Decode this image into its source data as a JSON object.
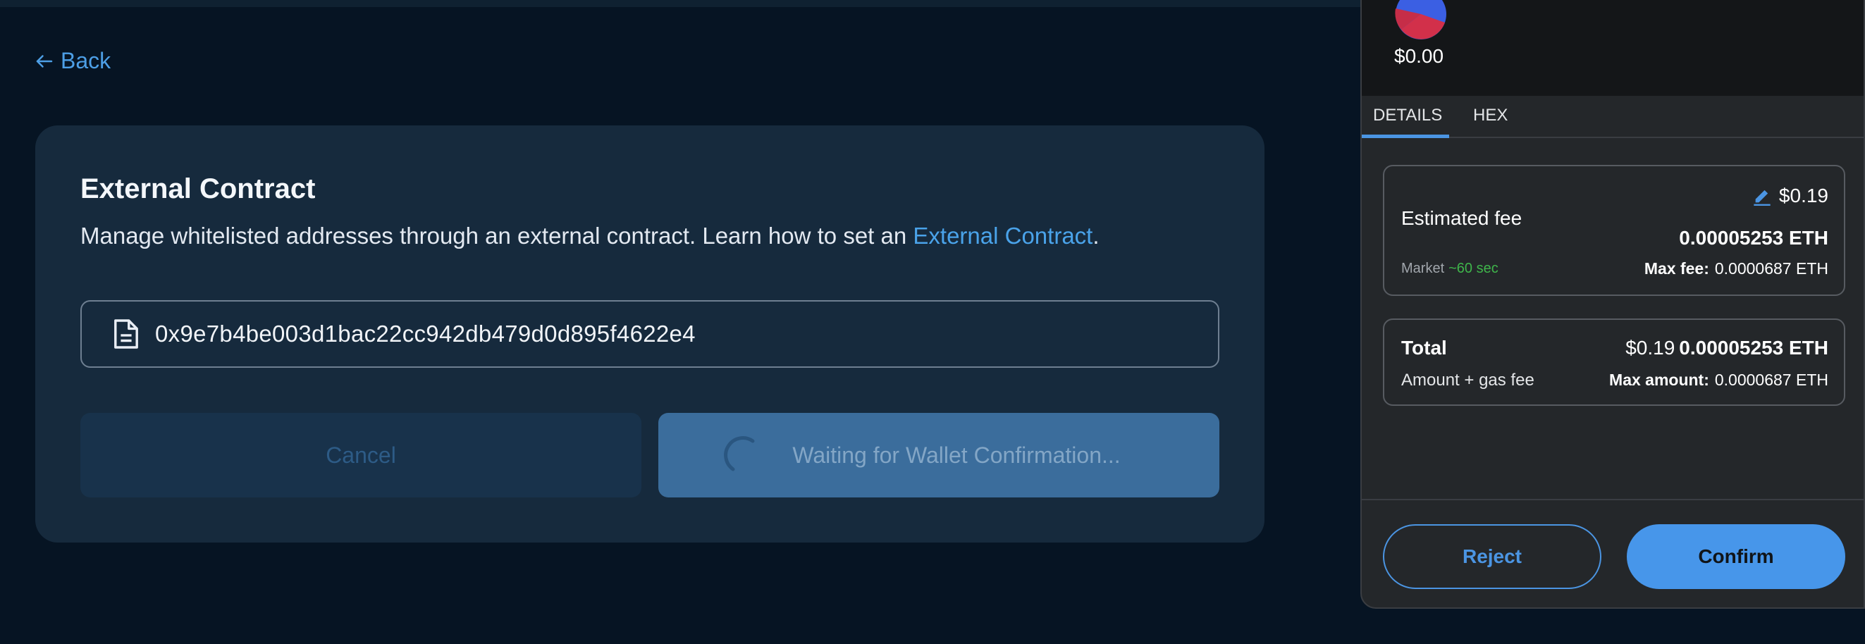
{
  "nav": {
    "back_label": "Back",
    "back_icon": "arrow-left-icon"
  },
  "card": {
    "title": "External Contract",
    "description": "Manage whitelisted addresses through an external contract. Learn how to set an ",
    "description_link": "External Contract",
    "description_end": ".",
    "address_icon": "document-icon",
    "address_value": "0x9e7b4be003d1bac22cc942db479d0d895f4622e4",
    "cancel_label": "Cancel",
    "waiting_label": "Waiting for Wallet Confirmation..."
  },
  "wallet": {
    "balance": "$0.00",
    "tabs": [
      {
        "label": "DETAILS",
        "active": true
      },
      {
        "label": "HEX",
        "active": false
      }
    ],
    "fee": {
      "label": "Estimated fee",
      "usd": "$0.19",
      "eth": "0.00005253 ETH",
      "market": "Market",
      "time": "~60 sec",
      "max_fee_label": "Max fee:",
      "max_fee_value": "0.0000687 ETH",
      "edit_icon": "pencil-icon"
    },
    "total": {
      "label": "Total",
      "sub": "Amount + gas fee",
      "usd": "$0.19",
      "eth": "0.00005253 ETH",
      "max_amount_label": "Max amount:",
      "max_amount_value": "0.0000687 ETH"
    },
    "reject_label": "Reject",
    "confirm_label": "Confirm"
  },
  "colors": {
    "background": "#061423",
    "card": "#162a3d",
    "link": "#4aa3ea",
    "wallet_panel": "#24272a",
    "accent": "#4796ea",
    "market_time": "#3fb54b"
  }
}
